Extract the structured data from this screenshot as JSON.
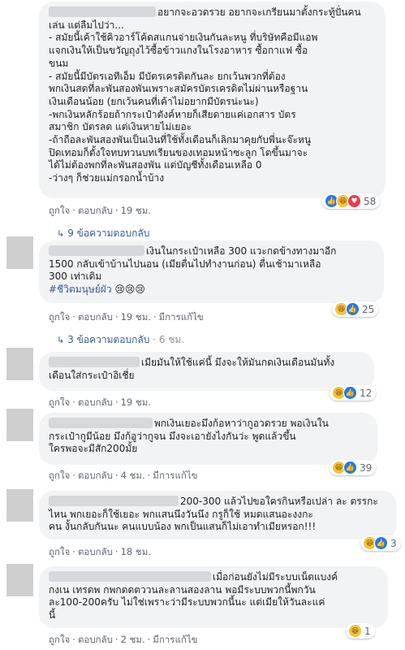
{
  "actions": {
    "like": "ถูกใจ",
    "reply": "ตอบกลับ",
    "edited": "มีการแก้ไข"
  },
  "comments": [
    {
      "text": "อยากจะอวดรวย อยากจะเกรียนมาตั้งกระทู้ปั่นคน\nเล่น แต่ลืมไปว่า...\n- สมัยนี้เค้าใช้คิวอาร์โค้ดสแกนจ่ายเงินกันละหนู ที่บริษัทคือมีแอพ\nแจกเงินให้เป็นขวัญถุงไว้ซื้อข้าวแกงในโรงอาหาร ซื้อกาแฟ ซื้อ\nขนม\n- สมัยนี้มีบัตรเอทีเอ็ม มีบัตรเครดิตกันละ ยกเว้นพวกที่ต้อง\nพกเงินสดที่ละพันสองพันเพราะสมัครบัตรเครดิตไม่ผ่านหรือฐาน\nเงินเดือนน้อย (ยกเว้นคนที่เค้าไม่อยากมีบัตรน่ะนะ)\n-พกเงินหลักร้อยถ้ากระเป๋าตังค์หายก็เสียดายแค่เอกสาร บัตร\nสมาชิก บัตรลด แต่เงินหายไม่เยอะ\n-ถ้าถือละพันสองพันเป็นเงินที่ใช้ทั้งเดือนก็เลิกมาคุยกับพี่นะจ๊ะหนู\nปิดเทอมก็ตั้งใจทบทวนบทเรียนของเทอมหน้าซะลูก โตขึ้นมาจะ\nได้ไม่ต้องพกที่ละพันสองพัน แต่บัญชีทั้งเดือนเหลือ 0\n-ว่างๆ ก็ช่วยแม่กรอกน้ำบ้าง",
      "time": "19 ชม.",
      "edited": false,
      "reactions": "58",
      "replies": "9 ข้อความตอบกลับ",
      "replies_time": ""
    },
    {
      "text": "เงินในกระเป๋าเหลือ 300 แวะกดข้างทางมาอีก\n1500 กลับเข้าบ้านไปนอน (เมียตื่นไปทำงานก่อน) ตื่นเช้ามาเหลือ\n300 เท่าเดิม",
      "tag": "#ชีวิตมนุษย์ผัว",
      "emoji": "😢😢😢",
      "time": "19 ชม.",
      "edited": true,
      "reactions": "25",
      "replies": "3 ข้อความตอบกลับ",
      "replies_time": "6 ชม."
    },
    {
      "text": "เมียมันให้ใช้แค่นี้ มึงจะให้มันกดเงินเดือนมันทั้ง\nเดือนใส่กระเป๋าอิเชี่ย",
      "time": "19 ชม.",
      "edited": false,
      "reactions": "12"
    },
    {
      "text": "พกเงินเยอะมึงก้อหาว่ากูอวดรวย พอเงินใน\nกระเป๋ากูมีน้อย มึงก้อูว่ากูจน มึงจะเอายังไงกันว่ะ พูดแล้วขึ้น\nใครพอจะมีสัก200มั้ย",
      "time": "4 ชม.",
      "edited": true,
      "reactions": "39"
    },
    {
      "text": "200-300 แล้วไปขอใครกินหรือเปล่า ละ ตรรกะ\nไหน พกเยอะก็ใช้เยอะ พกแสนนึงวันนึง กรูก็ใช้ หมดแสนอะงงกะ\nคน งั้นกลับกันนะ คนแบบน้อง พกเป็นแสนก็ไม่เอาทำเมียหรอก!!!",
      "time": "18 ชม.",
      "edited": false,
      "reactions": "3"
    },
    {
      "text": "เมื่อก่อนยังไม่มีระบบเน็ตแบงค์\nกงเน เทรดพ กพกตดตววนละลานสองลาน พอมีระบบพวกนี้พกวัน\nละ100-200ครับ ไม่ใช่เพราะว่ามีระบบพวกนี้นะ แต่เมียให้วันละแค่\nนี้",
      "time": "2 ชม.",
      "edited": true,
      "reactions": "1"
    }
  ]
}
